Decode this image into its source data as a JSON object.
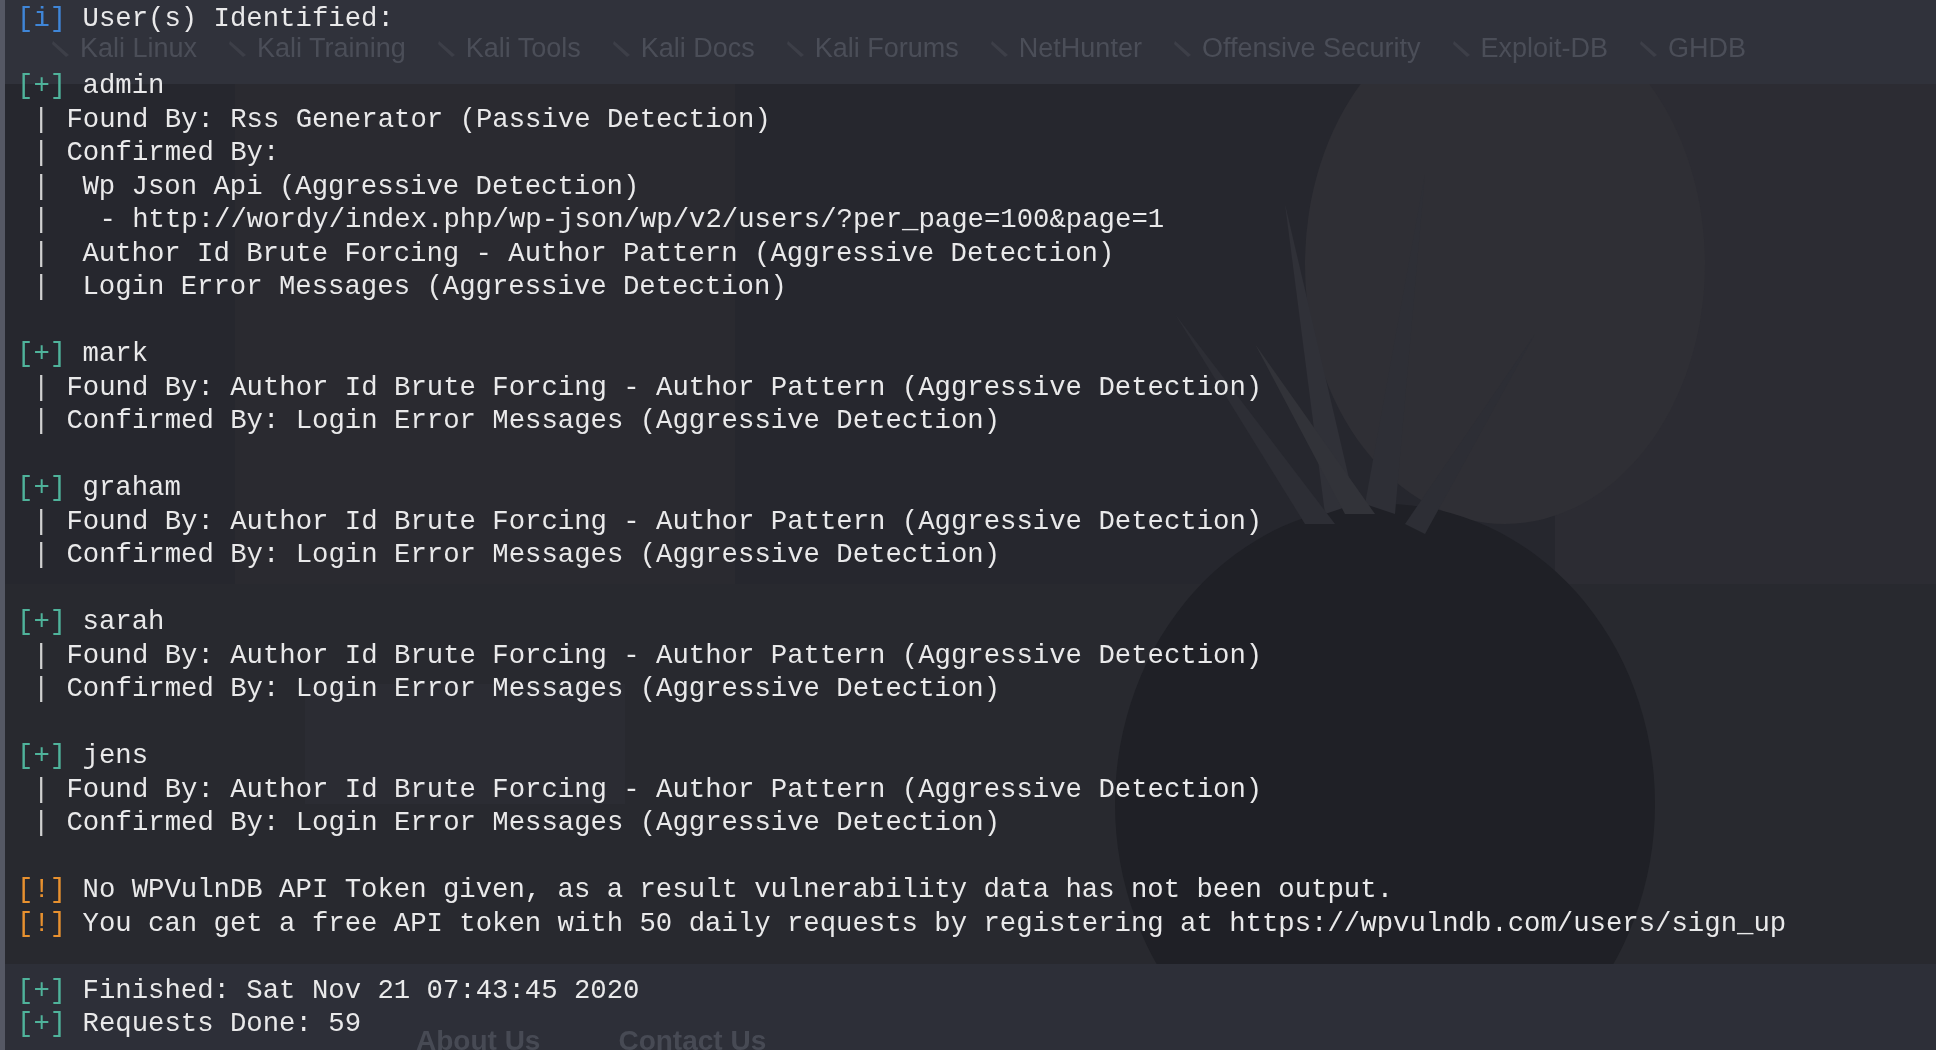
{
  "browser_background": {
    "bookmarks": [
      {
        "label": "Kali Linux"
      },
      {
        "label": "Kali Training"
      },
      {
        "label": "Kali Tools"
      },
      {
        "label": "Kali Docs"
      },
      {
        "label": "Kali Forums"
      },
      {
        "label": "NetHunter"
      },
      {
        "label": "Offensive Security"
      },
      {
        "label": "Exploit-DB"
      },
      {
        "label": "GHDB"
      }
    ],
    "footer_links": [
      "About Us",
      "Contact Us"
    ]
  },
  "terminal": {
    "lines": [
      {
        "kind": "info",
        "tag": "[i]",
        "text": "User(s) Identified:"
      },
      {
        "kind": "blank"
      },
      {
        "kind": "plus",
        "tag": "[+]",
        "text": "admin"
      },
      {
        "kind": "detail",
        "bar": "|",
        "text": "Found By: Rss Generator (Passive Detection)"
      },
      {
        "kind": "detail",
        "bar": "|",
        "text": "Confirmed By:"
      },
      {
        "kind": "sub",
        "bar": "|",
        "text": "Wp Json Api (Aggressive Detection)"
      },
      {
        "kind": "url",
        "bar": "|",
        "text": "- http://wordy/index.php/wp-json/wp/v2/users/?per_page=100&page=1"
      },
      {
        "kind": "sub",
        "bar": "|",
        "text": "Author Id Brute Forcing - Author Pattern (Aggressive Detection)"
      },
      {
        "kind": "sub",
        "bar": "|",
        "text": "Login Error Messages (Aggressive Detection)"
      },
      {
        "kind": "blank"
      },
      {
        "kind": "plus",
        "tag": "[+]",
        "text": "mark"
      },
      {
        "kind": "detail",
        "bar": "|",
        "text": "Found By: Author Id Brute Forcing - Author Pattern (Aggressive Detection)"
      },
      {
        "kind": "detail",
        "bar": "|",
        "text": "Confirmed By: Login Error Messages (Aggressive Detection)"
      },
      {
        "kind": "blank"
      },
      {
        "kind": "plus",
        "tag": "[+]",
        "text": "graham"
      },
      {
        "kind": "detail",
        "bar": "|",
        "text": "Found By: Author Id Brute Forcing - Author Pattern (Aggressive Detection)"
      },
      {
        "kind": "detail",
        "bar": "|",
        "text": "Confirmed By: Login Error Messages (Aggressive Detection)"
      },
      {
        "kind": "blank"
      },
      {
        "kind": "plus",
        "tag": "[+]",
        "text": "sarah"
      },
      {
        "kind": "detail",
        "bar": "|",
        "text": "Found By: Author Id Brute Forcing - Author Pattern (Aggressive Detection)"
      },
      {
        "kind": "detail",
        "bar": "|",
        "text": "Confirmed By: Login Error Messages (Aggressive Detection)"
      },
      {
        "kind": "blank"
      },
      {
        "kind": "plus",
        "tag": "[+]",
        "text": "jens"
      },
      {
        "kind": "detail",
        "bar": "|",
        "text": "Found By: Author Id Brute Forcing - Author Pattern (Aggressive Detection)"
      },
      {
        "kind": "detail",
        "bar": "|",
        "text": "Confirmed By: Login Error Messages (Aggressive Detection)"
      },
      {
        "kind": "blank"
      },
      {
        "kind": "warning",
        "tag": "[!]",
        "text": "No WPVulnDB API Token given, as a result vulnerability data has not been output."
      },
      {
        "kind": "warning",
        "tag": "[!]",
        "text": "You can get a free API token with 50 daily requests by registering at https://wpvulndb.com/users/sign_up"
      },
      {
        "kind": "blank"
      },
      {
        "kind": "plus",
        "tag": "[+]",
        "text": "Finished: Sat Nov 21 07:43:45 2020"
      },
      {
        "kind": "plus",
        "tag": "[+]",
        "text": "Requests Done: 59"
      }
    ]
  }
}
